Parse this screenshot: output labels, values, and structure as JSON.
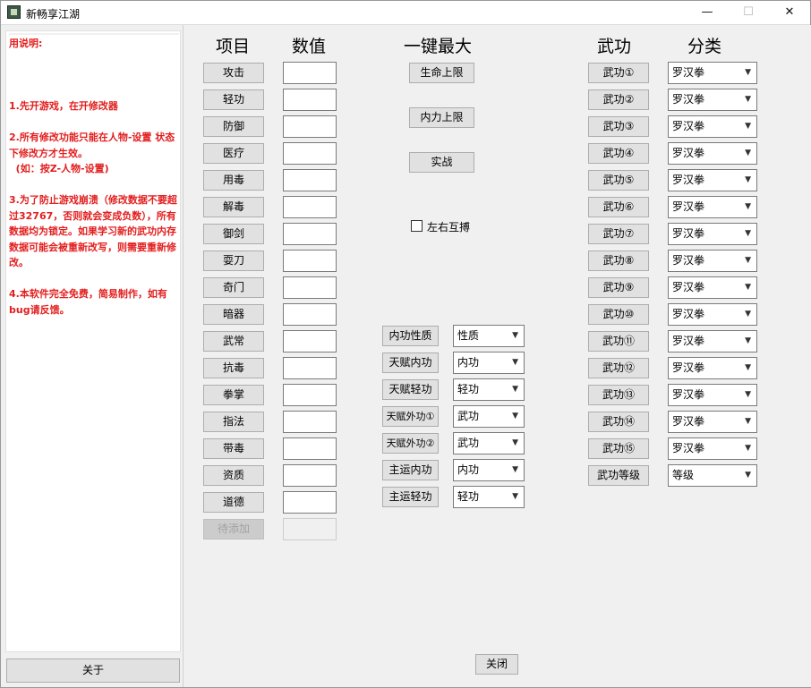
{
  "window": {
    "title": "新畅享江湖",
    "minimize": "—",
    "maximize": "☐",
    "close": "✕"
  },
  "instructions": {
    "text": "用说明:\n\n\n\n1.先开游戏，在开修改器\n\n2.所有修改功能只能在人物-设置 状态下修改方才生效。\n  (如：按Z-人物-设置)\n\n3.为了防止游戏崩溃（修改数据不要超过32767，否则就会变成负数），所有数据均为锁定。如果学习新的武功内存数据可能会被重新改写，则需要重新修改。\n\n4.本软件完全免费，简易制作，如有bug请反馈。"
  },
  "about_button": "关于",
  "headers": {
    "item": "项目",
    "value": "数值",
    "one_key_max": "一键最大",
    "martial": "武功",
    "category": "分类"
  },
  "attributes": [
    {
      "label": "攻击",
      "value": ""
    },
    {
      "label": "轻功",
      "value": ""
    },
    {
      "label": "防御",
      "value": ""
    },
    {
      "label": "医疗",
      "value": ""
    },
    {
      "label": "用毒",
      "value": ""
    },
    {
      "label": "解毒",
      "value": ""
    },
    {
      "label": "御剑",
      "value": ""
    },
    {
      "label": "耍刀",
      "value": ""
    },
    {
      "label": "奇门",
      "value": ""
    },
    {
      "label": "暗器",
      "value": ""
    },
    {
      "label": "武常",
      "value": ""
    },
    {
      "label": "抗毒",
      "value": ""
    },
    {
      "label": "拳掌",
      "value": ""
    },
    {
      "label": "指法",
      "value": ""
    },
    {
      "label": "带毒",
      "value": ""
    },
    {
      "label": "资质",
      "value": ""
    },
    {
      "label": "道德",
      "value": ""
    }
  ],
  "pending_button": "待添加",
  "max_buttons": {
    "hp_limit": "生命上限",
    "mp_limit": "内力上限",
    "combat": "实战"
  },
  "checkbox": {
    "label": "左右互搏",
    "checked": false
  },
  "mid_rows": [
    {
      "label": "内功性质",
      "selected": "性质"
    },
    {
      "label": "天赋内功",
      "selected": "内功"
    },
    {
      "label": "天赋轻功",
      "selected": "轻功"
    },
    {
      "label": "天赋外功①",
      "selected": "武功"
    },
    {
      "label": "天赋外功②",
      "selected": "武功"
    },
    {
      "label": "主运内功",
      "selected": "内功"
    },
    {
      "label": "主运轻功",
      "selected": "轻功"
    }
  ],
  "martial_rows": [
    {
      "label": "武功①",
      "selected": "罗汉拳"
    },
    {
      "label": "武功②",
      "selected": "罗汉拳"
    },
    {
      "label": "武功③",
      "selected": "罗汉拳"
    },
    {
      "label": "武功④",
      "selected": "罗汉拳"
    },
    {
      "label": "武功⑤",
      "selected": "罗汉拳"
    },
    {
      "label": "武功⑥",
      "selected": "罗汉拳"
    },
    {
      "label": "武功⑦",
      "selected": "罗汉拳"
    },
    {
      "label": "武功⑧",
      "selected": "罗汉拳"
    },
    {
      "label": "武功⑨",
      "selected": "罗汉拳"
    },
    {
      "label": "武功⑩",
      "selected": "罗汉拳"
    },
    {
      "label": "武功⑪",
      "selected": "罗汉拳"
    },
    {
      "label": "武功⑫",
      "selected": "罗汉拳"
    },
    {
      "label": "武功⑬",
      "selected": "罗汉拳"
    },
    {
      "label": "武功⑭",
      "selected": "罗汉拳"
    },
    {
      "label": "武功⑮",
      "selected": "罗汉拳"
    },
    {
      "label": "武功等级",
      "selected": "等级"
    }
  ],
  "close_button": "关闭",
  "icons": {
    "dropdown": "chevron-down-icon",
    "app": "app-icon"
  },
  "colors": {
    "instructions_text": "#e31e1e",
    "window_bg": "#f0f0f0",
    "button_bg": "#e1e1e1"
  }
}
